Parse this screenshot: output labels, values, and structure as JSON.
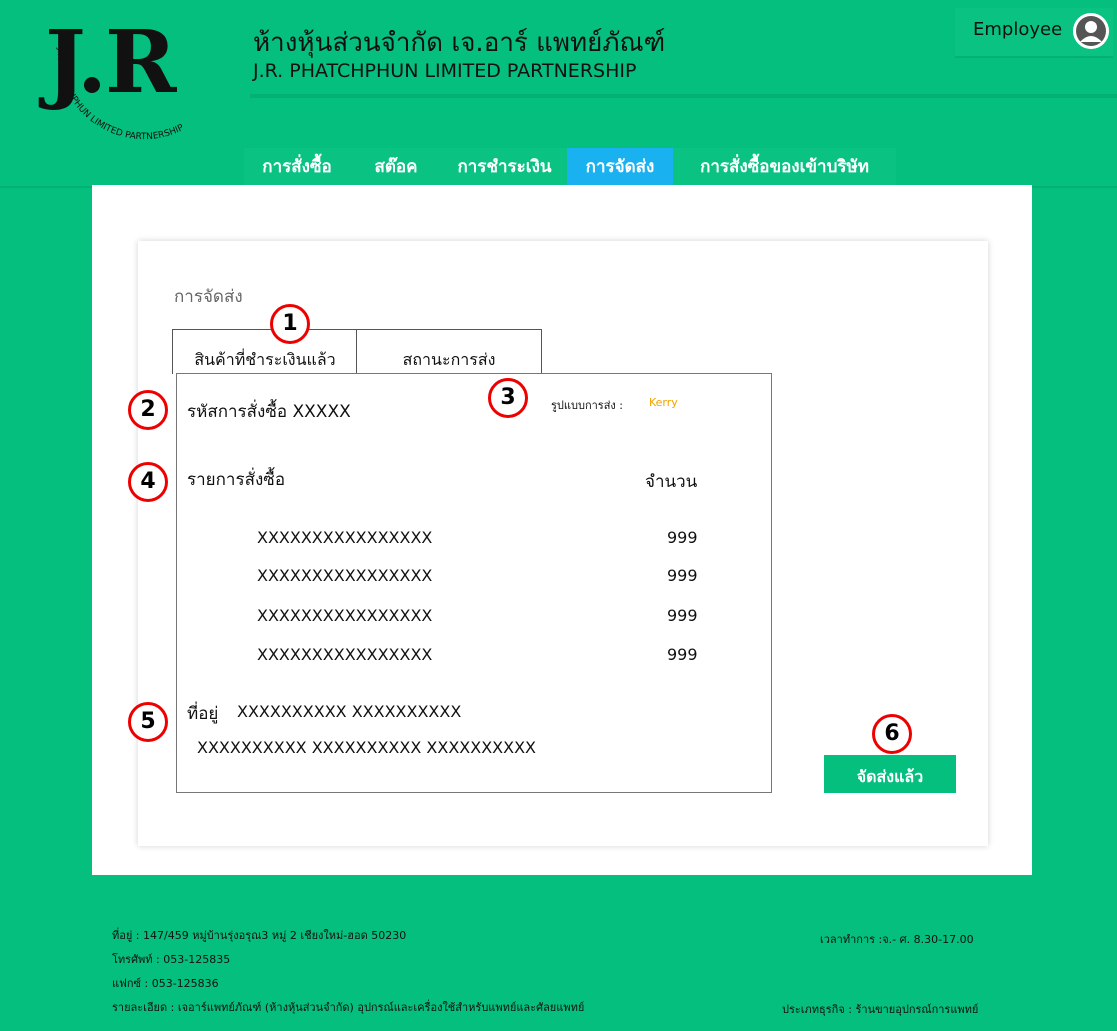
{
  "header": {
    "logo_text": "J.R",
    "logo_ring_text": "J.R. PHATCHPHUN LIMITED PARTNERSHIP",
    "company_name_th": "ห้างหุ้นส่วนจำกัด เจ.อาร์ แพทย์ภัณฑ์",
    "company_name_en": "J.R. PHATCHPHUN LIMITED PARTNERSHIP",
    "user_label": "Employee"
  },
  "nav": {
    "tabs": [
      {
        "label": "การสั่งซื้อ",
        "active": false
      },
      {
        "label": "สต๊อค",
        "active": false
      },
      {
        "label": "การชำระเงิน",
        "active": false
      },
      {
        "label": "การจัดส่ง",
        "active": true
      },
      {
        "label": "การสั่งซื้อของเข้าบริษัท",
        "active": false
      }
    ]
  },
  "page": {
    "title": "การจัดส่ง",
    "tabs": [
      {
        "label": "สินค้าที่ชำระเงินแล้ว"
      },
      {
        "label": "สถานะการส่ง"
      }
    ],
    "order_id_label": "รหัสการสั่งซื้อ XXXXX",
    "ship_method_label": "รูปแบบการส่ง :",
    "ship_method_value": "Kerry",
    "items_label": "รายการสั่งซื้อ",
    "qty_label": "จำนวน",
    "items": [
      {
        "name": "XXXXXXXXXXXXXXXX",
        "qty": "999"
      },
      {
        "name": "XXXXXXXXXXXXXXXX",
        "qty": "999"
      },
      {
        "name": "XXXXXXXXXXXXXXXX",
        "qty": "999"
      },
      {
        "name": "XXXXXXXXXXXXXXXX",
        "qty": "999"
      }
    ],
    "address_label": "ที่อยู่",
    "address_line1": "XXXXXXXXXX   XXXXXXXXXX",
    "address_line2": "XXXXXXXXXX   XXXXXXXXXX   XXXXXXXXXX",
    "shipped_button": "จัดส่งแล้ว"
  },
  "callouts": [
    "1",
    "2",
    "3",
    "4",
    "5",
    "6"
  ],
  "footer": {
    "address": "ที่อยู่ : 147/459 หมู่บ้านรุ่งอรุณ3 หมู่ 2 เชียงใหม่-ฮอด 50230",
    "phone": "โทรศัพท์ : 053-125835",
    "fax": "แฟกซ์ : 053-125836",
    "details": "รายละเอียด : เจอาร์แพทย์ภัณฑ์ (ห้างหุ้นส่วนจำกัด) อุปกรณ์และเครื่องใช้สำหรับแพทย์และศัลยแพทย์",
    "hours": "เวลาทำการ :จ.- ศ. 8.30-17.00",
    "business_type": "ประเภทธุรกิจ : ร้านขายอุปกรณ์การแพทย์"
  },
  "colors": {
    "brand_green": "#04bf7e",
    "active_tab": "#1ab1f0",
    "callout_red": "#e00000",
    "kerry_orange": "#f0a300"
  }
}
